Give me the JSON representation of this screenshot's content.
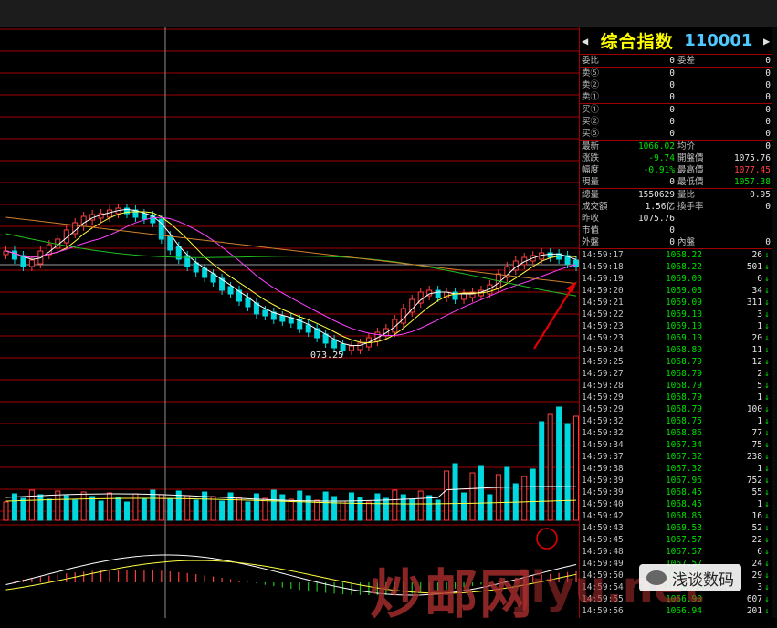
{
  "header": {
    "index_name": "综合指数",
    "index_code": "110001",
    "prev": "◀",
    "next": "▶"
  },
  "chart": {
    "low_label": "073.25"
  },
  "order": {
    "ratio_label": "委比",
    "ratio_val": "0",
    "diff_label": "委差",
    "diff_val": "0",
    "sell": [
      {
        "label": "卖⑤",
        "val": "0",
        "cnt": "0"
      },
      {
        "label": "卖②",
        "val": "0",
        "cnt": "0"
      },
      {
        "label": "卖①",
        "val": "0",
        "cnt": "0"
      }
    ],
    "buy": [
      {
        "label": "买①",
        "val": "0",
        "cnt": "0"
      },
      {
        "label": "买②",
        "val": "0",
        "cnt": "0"
      },
      {
        "label": "买⑤",
        "val": "0",
        "cnt": "0"
      }
    ]
  },
  "quote": [
    {
      "l1": "最新",
      "v1": "1066.02",
      "c1": "v-green",
      "l2": "均价",
      "v2": "0",
      "c2": "v-white"
    },
    {
      "l1": "涨跌",
      "v1": "-9.74",
      "c1": "v-green",
      "l2": "開盤價",
      "v2": "1075.76",
      "c2": "v-white"
    },
    {
      "l1": "幅度",
      "v1": "-0.91%",
      "c1": "v-green",
      "l2": "最高價",
      "v2": "1077.45",
      "c2": "v-red"
    },
    {
      "l1": "現量",
      "v1": "0",
      "c1": "v-white",
      "l2": "最低價",
      "v2": "1057.38",
      "c2": "v-green"
    },
    {
      "l1": "總量",
      "v1": "1550629",
      "c1": "v-white",
      "l2": "量比",
      "v2": "0.95",
      "c2": "v-white"
    },
    {
      "l1": "成交額",
      "v1": "1.56亿",
      "c1": "v-white",
      "l2": "換手率",
      "v2": "0",
      "c2": "v-white"
    },
    {
      "l1": "昨收",
      "v1": "1075.76",
      "c1": "v-white",
      "l2": "",
      "v2": "",
      "c2": "v-white"
    },
    {
      "l1": "市值",
      "v1": "0",
      "c1": "v-white",
      "l2": "",
      "v2": "",
      "c2": "v-white"
    },
    {
      "l1": "外盤",
      "v1": "0",
      "c1": "v-white",
      "l2": "內盤",
      "v2": "0",
      "c2": "v-white"
    }
  ],
  "ticks": [
    {
      "t": "14:59:17",
      "p": "1068.22",
      "v": "26",
      "d": "↓"
    },
    {
      "t": "14:59:18",
      "p": "1068.22",
      "v": "501",
      "d": "↓"
    },
    {
      "t": "14:59:19",
      "p": "1069.00",
      "v": "6",
      "d": "↓"
    },
    {
      "t": "14:59:20",
      "p": "1069.08",
      "v": "34",
      "d": "↓"
    },
    {
      "t": "14:59:21",
      "p": "1069.09",
      "v": "311",
      "d": "↓"
    },
    {
      "t": "14:59:22",
      "p": "1069.10",
      "v": "3",
      "d": "↓"
    },
    {
      "t": "14:59:23",
      "p": "1069.10",
      "v": "1",
      "d": "↓"
    },
    {
      "t": "14:59:23",
      "p": "1069.10",
      "v": "20",
      "d": "↓"
    },
    {
      "t": "14:59:24",
      "p": "1068.80",
      "v": "11",
      "d": "↓"
    },
    {
      "t": "14:59:25",
      "p": "1068.79",
      "v": "12",
      "d": "↓"
    },
    {
      "t": "14:59:27",
      "p": "1068.79",
      "v": "2",
      "d": "↓"
    },
    {
      "t": "14:59:28",
      "p": "1068.79",
      "v": "5",
      "d": "↓"
    },
    {
      "t": "14:59:29",
      "p": "1068.79",
      "v": "1",
      "d": "↓"
    },
    {
      "t": "14:59:29",
      "p": "1068.79",
      "v": "100",
      "d": "↓"
    },
    {
      "t": "14:59:32",
      "p": "1068.75",
      "v": "1",
      "d": "↓"
    },
    {
      "t": "14:59:32",
      "p": "1068.86",
      "v": "77",
      "d": "↓"
    },
    {
      "t": "14:59:34",
      "p": "1067.34",
      "v": "75",
      "d": "↓"
    },
    {
      "t": "14:59:37",
      "p": "1067.32",
      "v": "238",
      "d": "↓"
    },
    {
      "t": "14:59:38",
      "p": "1067.32",
      "v": "1",
      "d": "↓"
    },
    {
      "t": "14:59:39",
      "p": "1067.96",
      "v": "752",
      "d": "↓"
    },
    {
      "t": "14:59:39",
      "p": "1068.45",
      "v": "55",
      "d": "↓"
    },
    {
      "t": "14:59:40",
      "p": "1068.45",
      "v": "1",
      "d": "↓"
    },
    {
      "t": "14:59:42",
      "p": "1068.85",
      "v": "16",
      "d": "↓"
    },
    {
      "t": "14:59:43",
      "p": "1069.53",
      "v": "52",
      "d": "↓"
    },
    {
      "t": "14:59:45",
      "p": "1067.57",
      "v": "22",
      "d": "↓"
    },
    {
      "t": "14:59:48",
      "p": "1067.57",
      "v": "6",
      "d": "↓"
    },
    {
      "t": "14:59:49",
      "p": "1067.57",
      "v": "24",
      "d": "↓"
    },
    {
      "t": "14:59:50",
      "p": "1067.57",
      "v": "29",
      "d": "↓"
    },
    {
      "t": "14:59:54",
      "p": "1066.90",
      "v": "3",
      "d": "↓"
    },
    {
      "t": "14:59:55",
      "p": "1066.90",
      "v": "607",
      "d": "↓"
    },
    {
      "t": "14:59:56",
      "p": "1066.94",
      "v": "201",
      "d": "↓"
    }
  ],
  "watermark": {
    "text": "炒邮网",
    "url": "jiyu.net",
    "badge": "浅谈数码"
  },
  "colors": {
    "grid": "#a00000",
    "up": "#ff4040",
    "down": "#00d8e0",
    "ma5": "#ffffff",
    "ma10": "#ffff40",
    "ma20": "#ff40ff",
    "ma60": "#20c020"
  }
}
